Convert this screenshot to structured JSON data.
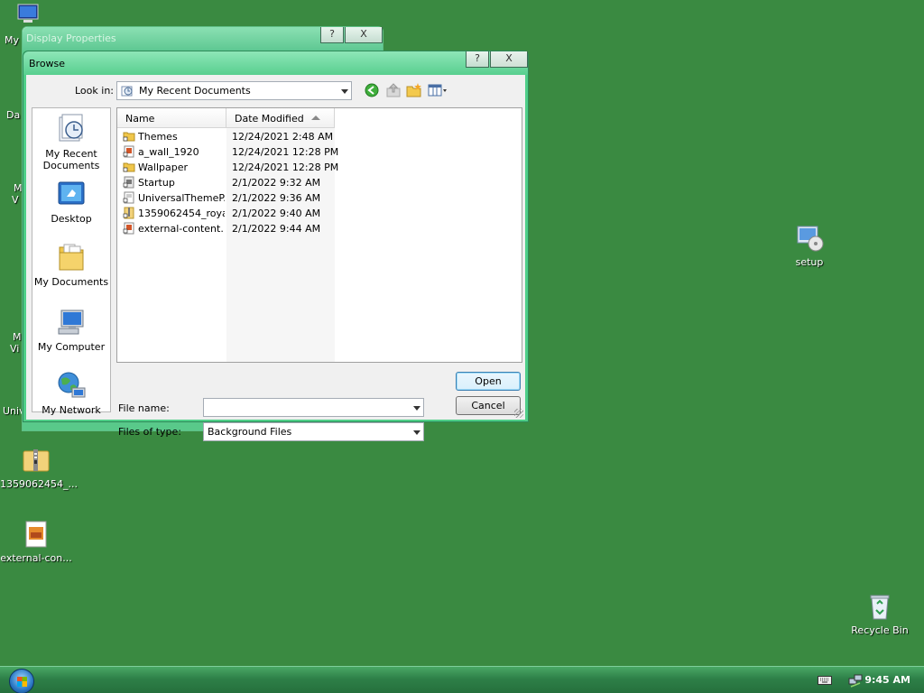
{
  "desktop": {
    "left_labels": [
      "My",
      "Da",
      "M",
      "V",
      "M",
      "Vi",
      "Univ"
    ],
    "icons": {
      "setup": "setup",
      "zip": "1359062454_...",
      "external": "external-con...",
      "recycle": "Recycle Bin"
    }
  },
  "background_window": {
    "title": "Display Properties",
    "help_btn": "?",
    "close_btn": "X"
  },
  "dialog": {
    "title": "Browse",
    "help_btn": "?",
    "close_btn": "X",
    "look_in_label": "Look in:",
    "look_in_value": "My Recent Documents",
    "toolbar_icons": [
      "back-icon",
      "up-folder-icon",
      "new-folder-icon",
      "views-menu-icon"
    ],
    "places": [
      {
        "label": "My Recent Documents",
        "icon": "recent-documents-icon"
      },
      {
        "label": "Desktop",
        "icon": "desktop-icon"
      },
      {
        "label": "My Documents",
        "icon": "my-documents-icon"
      },
      {
        "label": "My Computer",
        "icon": "my-computer-icon"
      },
      {
        "label": "My Network",
        "icon": "my-network-icon"
      }
    ],
    "columns": {
      "name": "Name",
      "date_modified": "Date Modified"
    },
    "files": [
      {
        "name": "Themes",
        "date": "12/24/2021 2:48 AM",
        "icon": "folder-shortcut-icon"
      },
      {
        "name": "a_wall_1920",
        "date": "12/24/2021 12:28 PM",
        "icon": "image-shortcut-icon"
      },
      {
        "name": "Wallpaper",
        "date": "12/24/2021 12:28 PM",
        "icon": "folder-shortcut-icon"
      },
      {
        "name": "Startup",
        "date": "2/1/2022 9:32 AM",
        "icon": "shortcut-icon"
      },
      {
        "name": "UniversalThemeP...",
        "date": "2/1/2022 9:36 AM",
        "icon": "file-shortcut-icon"
      },
      {
        "name": "1359062454_roya...",
        "date": "2/1/2022 9:40 AM",
        "icon": "zip-shortcut-icon"
      },
      {
        "name": "external-content...",
        "date": "2/1/2022 9:44 AM",
        "icon": "image-shortcut-icon"
      }
    ],
    "file_name_label": "File name:",
    "file_name_value": "",
    "files_of_type_label": "Files of type:",
    "files_of_type_value": "Background Files",
    "open_btn": "Open",
    "cancel_btn": "Cancel"
  },
  "taskbar": {
    "clock": "9:45 AM"
  },
  "colors": {
    "desktop": "#3a8a41",
    "titlebar": "#58cf8f",
    "taskbar": "#2e8048"
  }
}
